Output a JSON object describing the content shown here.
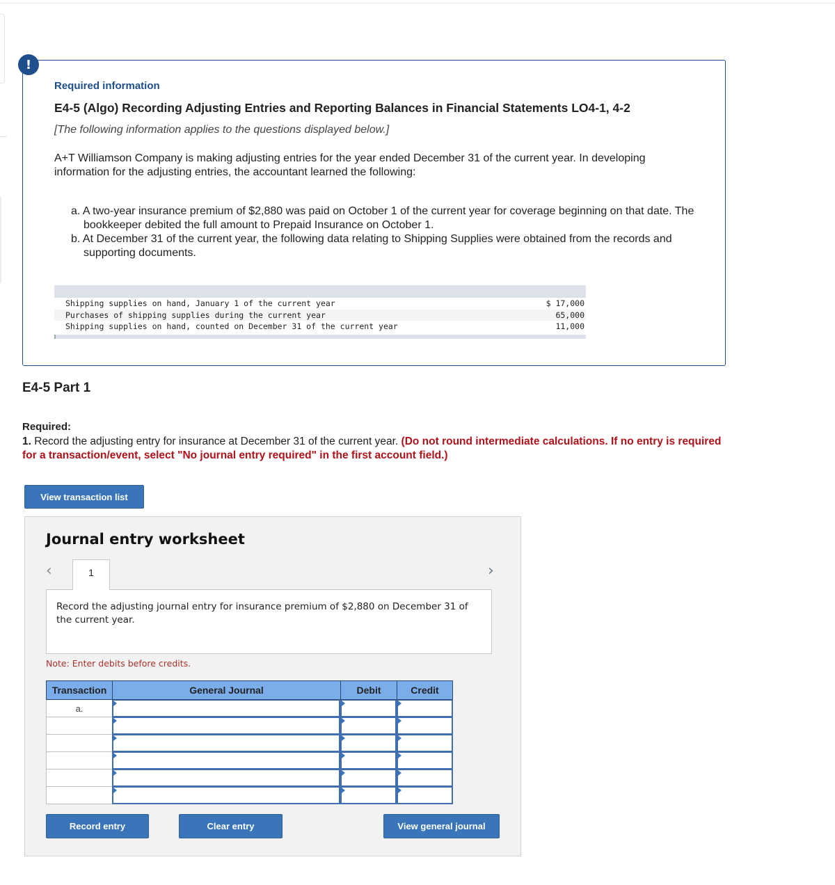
{
  "info": {
    "alert_icon": "!",
    "required_info_label": "Required information",
    "exercise_title": "E4-5 (Algo) Recording Adjusting Entries and Reporting Balances in Financial Statements LO4-1, 4-2",
    "applies_note": "[The following information applies to the questions displayed below.]",
    "intro": "A+T Williamson Company is making adjusting entries for the year ended December 31 of the current year. In developing information for the adjusting entries, the accountant learned the following:",
    "items": [
      "a. A two-year insurance premium of $2,880 was paid on October 1 of the current year for coverage beginning on that date. The bookkeeper debited the full amount to Prepaid Insurance on October 1.",
      "b. At December 31 of the current year, the following data relating to Shipping Supplies were obtained from the records and supporting documents."
    ],
    "supplies_table": [
      {
        "label": "Shipping supplies on hand, January 1 of the current year",
        "value": "$ 17,000"
      },
      {
        "label": "Purchases of shipping supplies during the current year",
        "value": "65,000"
      },
      {
        "label": "Shipping supplies on hand, counted on December 31 of the current year",
        "value": "11,000"
      }
    ]
  },
  "part": {
    "title": "E4-5 Part 1",
    "required_label": "Required:",
    "required_number": "1.",
    "required_text": " Record the adjusting entry for insurance at December 31 of the current year. ",
    "required_warning": "(Do not round intermediate calculations. If no entry is required for a transaction/event, select \"No journal entry required\" in the first account field.)"
  },
  "buttons": {
    "view_transaction_list": "View transaction list",
    "record_entry": "Record entry",
    "clear_entry": "Clear entry",
    "view_general_journal": "View general journal"
  },
  "worksheet": {
    "title": "Journal entry worksheet",
    "prev_icon": "‹",
    "next_icon": "›",
    "tab_label": "1",
    "prompt": "Record the adjusting journal entry for insurance premium of $2,880 on December 31 of the current year.",
    "note": "Note: Enter debits before credits.",
    "columns": [
      "Transaction",
      "General Journal",
      "Debit",
      "Credit"
    ],
    "rows": [
      {
        "transaction": "a.",
        "account": "",
        "debit": "",
        "credit": ""
      },
      {
        "transaction": "",
        "account": "",
        "debit": "",
        "credit": ""
      },
      {
        "transaction": "",
        "account": "",
        "debit": "",
        "credit": ""
      },
      {
        "transaction": "",
        "account": "",
        "debit": "",
        "credit": ""
      },
      {
        "transaction": "",
        "account": "",
        "debit": "",
        "credit": ""
      },
      {
        "transaction": "",
        "account": "",
        "debit": "",
        "credit": ""
      }
    ]
  }
}
